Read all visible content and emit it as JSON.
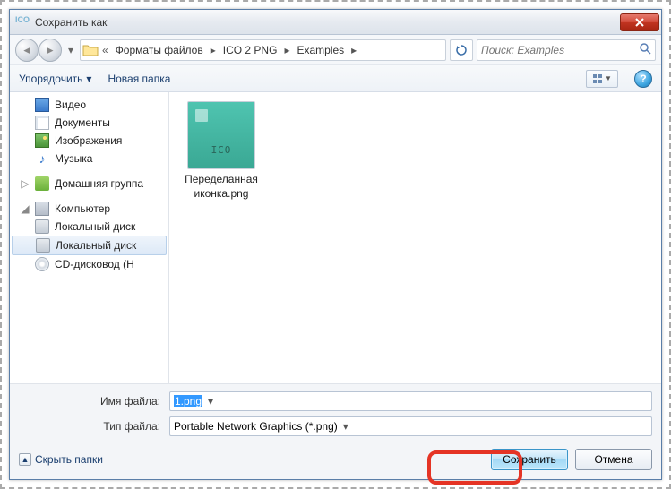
{
  "window": {
    "title": "Сохранить как",
    "app_icon_text": "ICO"
  },
  "nav": {
    "crumbs_prefix": "«",
    "crumbs": [
      "Форматы файлов",
      "ICO 2 PNG",
      "Examples"
    ],
    "search_placeholder": "Поиск: Examples"
  },
  "toolbar": {
    "organize": "Упорядочить",
    "new_folder": "Новая папка"
  },
  "sidebar": {
    "items": [
      {
        "label": "Видео",
        "icon": "video-icon"
      },
      {
        "label": "Документы",
        "icon": "document-icon"
      },
      {
        "label": "Изображения",
        "icon": "image-icon"
      },
      {
        "label": "Музыка",
        "icon": "music-icon"
      }
    ],
    "homegroup": {
      "label": "Домашняя группа"
    },
    "computer": {
      "label": "Компьютер",
      "children": [
        {
          "label": "Локальный диск",
          "icon": "disk-icon"
        },
        {
          "label": "Локальный диск",
          "icon": "disk-icon",
          "selected": true
        },
        {
          "label": "CD-дисковод (H",
          "icon": "cd-icon"
        }
      ]
    }
  },
  "files": [
    {
      "thumb_label": "ICO",
      "name": "Переделанная иконка.png"
    }
  ],
  "fields": {
    "filename_label": "Имя файла:",
    "filename_value": "1.png",
    "filetype_label": "Тип файла:",
    "filetype_value": "Portable Network Graphics (*.png)"
  },
  "buttons": {
    "hide_folders": "Скрыть папки",
    "save": "Сохранить",
    "cancel": "Отмена"
  }
}
